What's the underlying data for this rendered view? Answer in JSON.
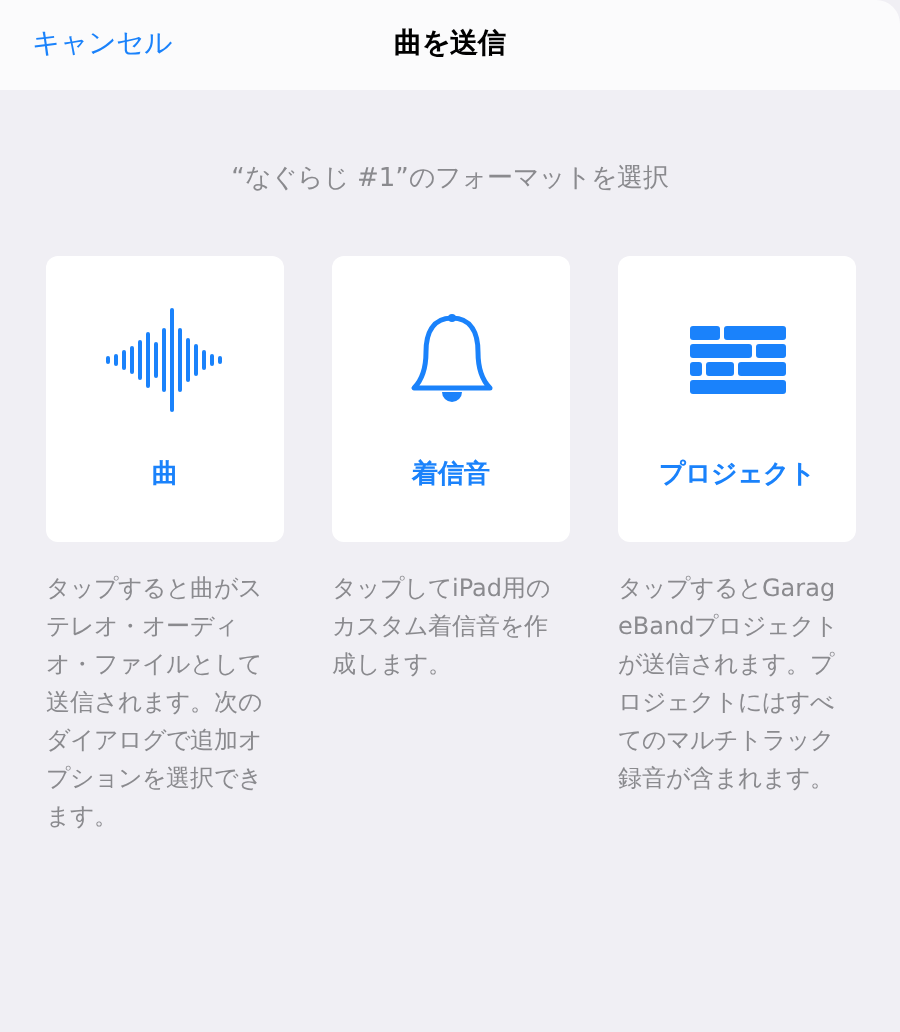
{
  "header": {
    "cancel": "キャンセル",
    "title": "曲を送信"
  },
  "prompt": "“なぐらじ #1”のフォーマットを選択",
  "options": [
    {
      "kind": "waveform",
      "label": "曲",
      "description": "タップすると曲がステレオ・オーディオ・ファイルとして送信されます。次のダイアログで追加オプションを選択できます。"
    },
    {
      "kind": "bell",
      "label": "着信音",
      "description": "タップしてiPad用のカスタム着信音を作成します。"
    },
    {
      "kind": "bricks",
      "label": "プロジェクト",
      "description": "タップするとGarageBandプロジェクトが送信されます。プロジェクトにはすべてのマルチトラック録音が含まれます。"
    }
  ]
}
